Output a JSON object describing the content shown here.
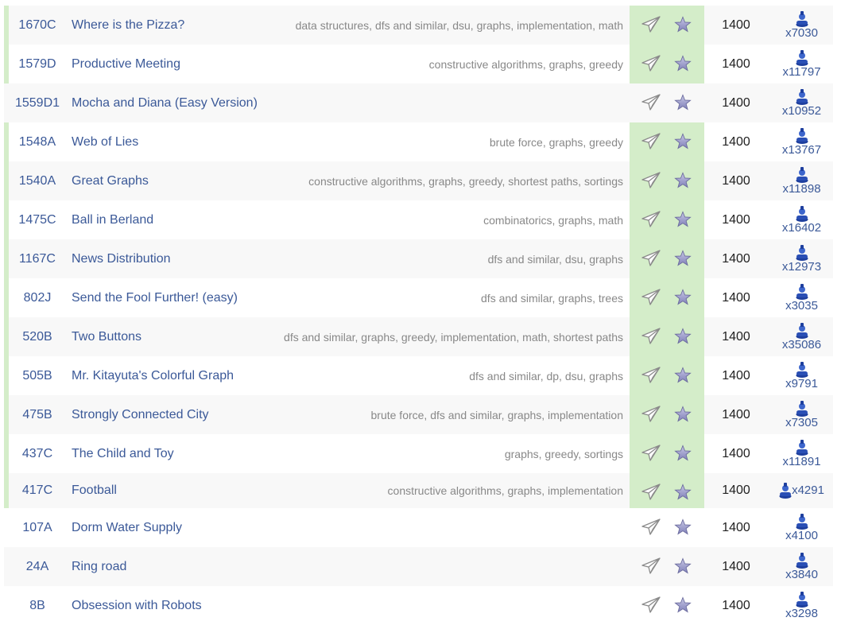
{
  "problems": [
    {
      "id": "1670C",
      "name": "Where is the Pizza?",
      "tags": "data structures, dfs and similar, dsu, graphs, implementation, math",
      "difficulty": "1400",
      "solved_count": "x7030",
      "solved": true
    },
    {
      "id": "1579D",
      "name": "Productive Meeting",
      "tags": "constructive algorithms, graphs, greedy",
      "difficulty": "1400",
      "solved_count": "x11797",
      "solved": true
    },
    {
      "id": "1559D1",
      "name": "Mocha and Diana (Easy Version)",
      "tags": "",
      "difficulty": "1400",
      "solved_count": "x10952",
      "solved": false
    },
    {
      "id": "1548A",
      "name": "Web of Lies",
      "tags": "brute force, graphs, greedy",
      "difficulty": "1400",
      "solved_count": "x13767",
      "solved": true
    },
    {
      "id": "1540A",
      "name": "Great Graphs",
      "tags": "constructive algorithms, graphs, greedy, shortest paths, sortings",
      "difficulty": "1400",
      "solved_count": "x11898",
      "solved": true
    },
    {
      "id": "1475C",
      "name": "Ball in Berland",
      "tags": "combinatorics, graphs, math",
      "difficulty": "1400",
      "solved_count": "x16402",
      "solved": true
    },
    {
      "id": "1167C",
      "name": "News Distribution",
      "tags": "dfs and similar, dsu, graphs",
      "difficulty": "1400",
      "solved_count": "x12973",
      "solved": true
    },
    {
      "id": "802J",
      "name": "Send the Fool Further! (easy)",
      "tags": "dfs and similar, graphs, trees",
      "difficulty": "1400",
      "solved_count": "x3035",
      "solved": true
    },
    {
      "id": "520B",
      "name": "Two Buttons",
      "tags": "dfs and similar, graphs, greedy, implementation, math, shortest paths",
      "difficulty": "1400",
      "solved_count": "x35086",
      "solved": true
    },
    {
      "id": "505B",
      "name": "Mr. Kitayuta's Colorful Graph",
      "tags": "dfs and similar, dp, dsu, graphs",
      "difficulty": "1400",
      "solved_count": "x9791",
      "solved": true
    },
    {
      "id": "475B",
      "name": "Strongly Connected City",
      "tags": "brute force, dfs and similar, graphs, implementation",
      "difficulty": "1400",
      "solved_count": "x7305",
      "solved": true
    },
    {
      "id": "437C",
      "name": "The Child and Toy",
      "tags": "graphs, greedy, sortings",
      "difficulty": "1400",
      "solved_count": "x11891",
      "solved": true
    },
    {
      "id": "417C",
      "name": "Football",
      "tags": "constructive algorithms, graphs, implementation",
      "difficulty": "1400",
      "solved_count": "x4291",
      "solved": true
    },
    {
      "id": "107A",
      "name": "Dorm Water Supply",
      "tags": "",
      "difficulty": "1400",
      "solved_count": "x4100",
      "solved": false
    },
    {
      "id": "24A",
      "name": "Ring road",
      "tags": "",
      "difficulty": "1400",
      "solved_count": "x3840",
      "solved": false
    },
    {
      "id": "8B",
      "name": "Obsession with Robots",
      "tags": "",
      "difficulty": "1400",
      "solved_count": "x3298",
      "solved": false
    }
  ],
  "colors": {
    "link": "#3b5998",
    "tag_text": "#888888",
    "solved_green": "#d4edc9",
    "row_alt": "#f8f8f8",
    "user_icon": "#2a4fb5"
  },
  "icons": {
    "submit": "paper-plane-icon",
    "favourite": "star-icon",
    "solved_by": "user-icon"
  }
}
